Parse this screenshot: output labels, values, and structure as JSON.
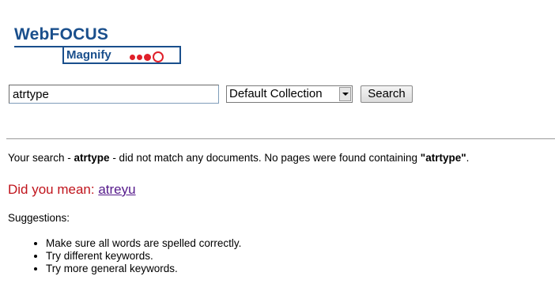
{
  "logo": {
    "brand": "WebFOCUS",
    "product": "Magnify",
    "colors": {
      "brand_blue": "#1a4f8c",
      "dot_red": "#e0202a"
    }
  },
  "search": {
    "query": "atrtype",
    "collection": "Default Collection",
    "button_label": "Search"
  },
  "result": {
    "prefix": "Your search - ",
    "query": "atrtype",
    "middle": " - did not match any documents. No pages were found containing ",
    "quoted_query": "\"atrtype\"",
    "suffix": "."
  },
  "did_you_mean": {
    "label": "Did you mean: ",
    "suggestion": "atreyu",
    "colors": {
      "label": "#c0141c",
      "link": "#551a8b"
    }
  },
  "suggestions": {
    "title": "Suggestions:",
    "items": [
      "Make sure all words are spelled correctly.",
      "Try different keywords.",
      "Try more general keywords."
    ]
  }
}
